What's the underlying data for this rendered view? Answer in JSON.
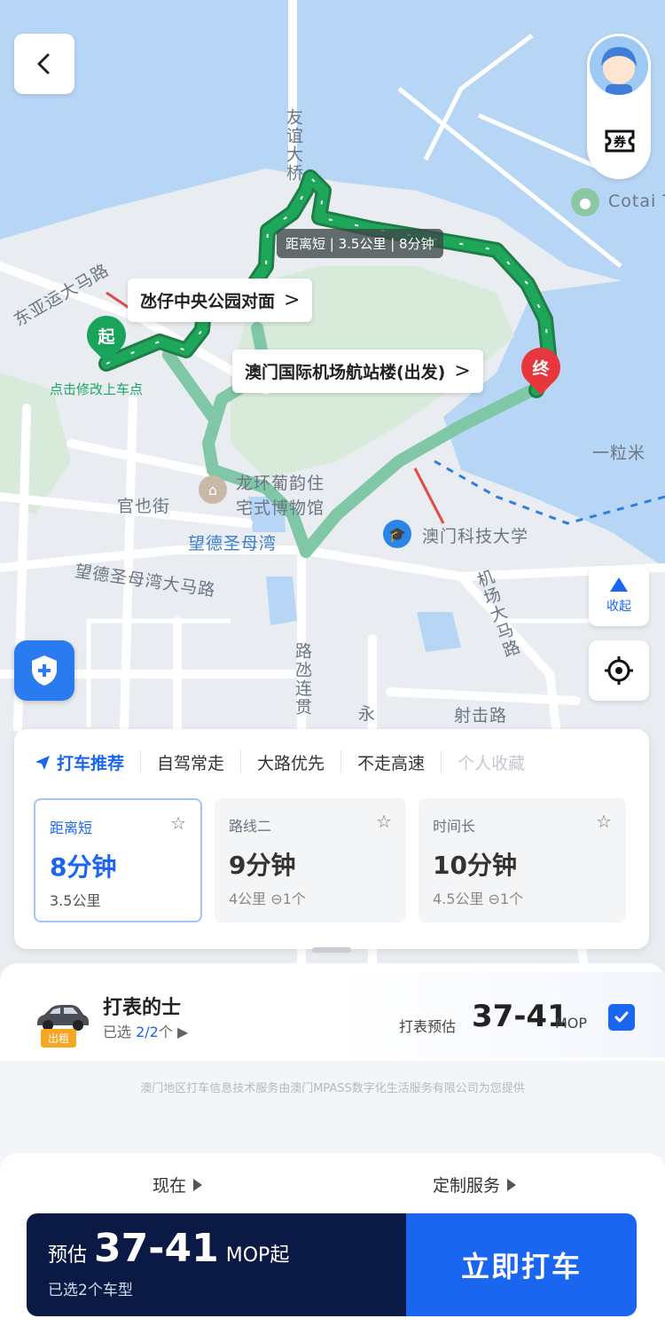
{
  "map": {
    "route_tag": "距离短 | 3.5公里 | 8分钟",
    "pickup_card": "氹仔中央公园对面",
    "destination_card": "澳门国际机场航站楼(出发)",
    "start_pin": "起",
    "end_pin": "终",
    "start_hint": "点击修改上车点",
    "labels": {
      "friendship_bridge": "友谊大桥",
      "east_asian_road": "东亚运大马路",
      "guanye_st": "官也街",
      "museum": "龙环葡韵住宅式博物馆",
      "museum_line1": "龙环葡韵住",
      "museum_line2": "宅式博物馆",
      "bay": "望德圣母湾",
      "bay_road": "望德圣母湾大马路",
      "must": "澳门科技大学",
      "airport_road": "机场大马路",
      "shooting_road": "射击路",
      "cotai": "Cotai T",
      "grain": "一粒米",
      "feilian": "路氹连贯",
      "yong": "永"
    },
    "collapse_label": "收起"
  },
  "icons": {
    "back": "chevron-left-icon",
    "coupon": "coupon-icon",
    "collapse": "triangle-up-icon",
    "locate": "locate-icon",
    "shield": "shield-plus-icon",
    "send": "paper-plane-icon",
    "star": "star-outline-icon",
    "toll": "toll-icon",
    "checkbox": "checkbox-checked-icon"
  },
  "route_tabs": [
    {
      "label": "打车推荐"
    },
    {
      "label": "自驾常走"
    },
    {
      "label": "大路优先"
    },
    {
      "label": "不走高速"
    },
    {
      "label": "个人收藏"
    }
  ],
  "routes": [
    {
      "name": "距离短",
      "time": "8分钟",
      "distance": "3.5公里",
      "tolls": ""
    },
    {
      "name": "路线二",
      "time": "9分钟",
      "distance": "4公里",
      "tolls": "1个"
    },
    {
      "name": "时间长",
      "time": "10分钟",
      "distance": "4.5公里",
      "tolls": "1个"
    }
  ],
  "taxi": {
    "name": "打表的士",
    "badge": "出租",
    "selected_prefix": "已选 ",
    "selected_count": "2/2",
    "selected_suffix": "个",
    "price_label": "打表预估",
    "price": "37-41",
    "unit": "MOP"
  },
  "disclaimer": "澳门地区打车信息技术服务由澳门MPASS数字化生活服务有限公司为您提供",
  "options": {
    "now": "现在",
    "custom": "定制服务"
  },
  "cta": {
    "prefix": "预估",
    "price": "37-41",
    "suffix": "MOP起",
    "selected": "已选2个车型",
    "button": "立即打车"
  },
  "colors": {
    "route_green": "#1ea65a",
    "alt_route": "#7fc7a6",
    "accent_blue": "#1a66f0",
    "water": "#b7d6f5",
    "cta_dark": "#0a1a45"
  }
}
